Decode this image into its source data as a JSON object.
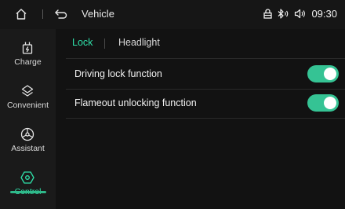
{
  "header": {
    "title": "Vehicle",
    "time": "09:30",
    "icons": [
      "home-icon",
      "back-icon",
      "lock-status-icon",
      "bluetooth-icon",
      "volume-icon"
    ]
  },
  "sidebar": {
    "items": [
      {
        "label": "Charge",
        "icon": "charge-icon"
      },
      {
        "label": "Convenient",
        "icon": "convenient-icon"
      },
      {
        "label": "Assistant",
        "icon": "assistant-icon"
      },
      {
        "label": "Control",
        "icon": "control-icon",
        "active": true
      }
    ]
  },
  "tabs": [
    {
      "label": "Lock",
      "active": true
    },
    {
      "label": "Headlight",
      "active": false
    }
  ],
  "settings": [
    {
      "label": "Driving lock function",
      "enabled": true
    },
    {
      "label": "Flameout unlocking function",
      "enabled": true
    }
  ],
  "colors": {
    "accent": "#2fe0a9",
    "toggle_on": "#35c394",
    "background": "#121212"
  }
}
